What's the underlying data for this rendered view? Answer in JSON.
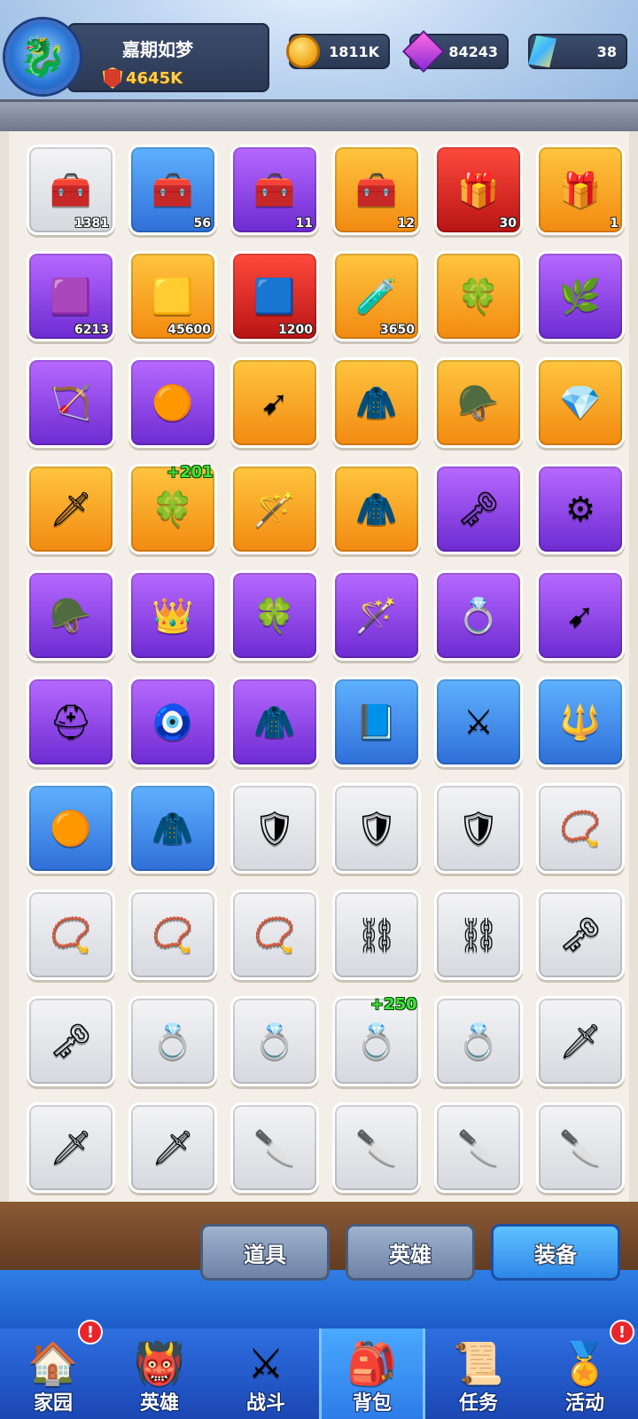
{
  "header": {
    "player_name": "嘉期如梦",
    "power": "4645K",
    "avatar_icon": "dragon-avatar-icon",
    "currencies": [
      {
        "name": "coin",
        "icon": "coin-icon",
        "value": "1811K"
      },
      {
        "name": "gem",
        "icon": "gem-icon",
        "value": "84243"
      },
      {
        "name": "crystal",
        "icon": "crystal-icon",
        "value": "38"
      }
    ]
  },
  "inventory": {
    "items": [
      {
        "icon": "chest",
        "glyph": "🧰",
        "rarity": "gray",
        "count": "1381"
      },
      {
        "icon": "chest",
        "glyph": "🧰",
        "rarity": "blue",
        "count": "56"
      },
      {
        "icon": "chest",
        "glyph": "🧰",
        "rarity": "purple",
        "count": "11"
      },
      {
        "icon": "chest",
        "glyph": "🧰",
        "rarity": "orange",
        "count": "12"
      },
      {
        "icon": "chest",
        "glyph": "🎁",
        "rarity": "red",
        "count": "30"
      },
      {
        "icon": "chest",
        "glyph": "🎁",
        "rarity": "orange",
        "count": "1"
      },
      {
        "icon": "bar",
        "glyph": "🟪",
        "rarity": "purple",
        "count": "6213"
      },
      {
        "icon": "bar",
        "glyph": "🟨",
        "rarity": "orange",
        "count": "45600"
      },
      {
        "icon": "bar",
        "glyph": "🟦",
        "rarity": "red",
        "count": "1200"
      },
      {
        "icon": "potion",
        "glyph": "🧪",
        "rarity": "orange",
        "count": "3650"
      },
      {
        "icon": "clover",
        "glyph": "🍀",
        "rarity": "orange",
        "count": ""
      },
      {
        "icon": "branch",
        "glyph": "🌿",
        "rarity": "purple",
        "count": ""
      },
      {
        "icon": "bow",
        "glyph": "🏹",
        "rarity": "purple",
        "count": ""
      },
      {
        "icon": "belt",
        "glyph": "🟠",
        "rarity": "purple",
        "count": ""
      },
      {
        "icon": "arrow",
        "glyph": "➹",
        "rarity": "orange",
        "count": ""
      },
      {
        "icon": "cape",
        "glyph": "🧥",
        "rarity": "orange",
        "count": ""
      },
      {
        "icon": "helm",
        "glyph": "🪖",
        "rarity": "orange",
        "count": ""
      },
      {
        "icon": "necklace",
        "glyph": "💎",
        "rarity": "orange",
        "count": ""
      },
      {
        "icon": "sword",
        "glyph": "🗡",
        "rarity": "orange",
        "count": ""
      },
      {
        "icon": "clover",
        "glyph": "🍀",
        "rarity": "orange",
        "count": "",
        "plus": "+201"
      },
      {
        "icon": "wand",
        "glyph": "🪄",
        "rarity": "orange",
        "count": ""
      },
      {
        "icon": "cape",
        "glyph": "🧥",
        "rarity": "orange",
        "count": ""
      },
      {
        "icon": "amulet",
        "glyph": "🗝",
        "rarity": "purple",
        "count": ""
      },
      {
        "icon": "amulet",
        "glyph": "⚙",
        "rarity": "purple",
        "count": ""
      },
      {
        "icon": "helm",
        "glyph": "🪖",
        "rarity": "purple",
        "count": ""
      },
      {
        "icon": "crown",
        "glyph": "👑",
        "rarity": "purple",
        "count": ""
      },
      {
        "icon": "clover",
        "glyph": "🍀",
        "rarity": "purple",
        "count": ""
      },
      {
        "icon": "wand",
        "glyph": "🪄",
        "rarity": "purple",
        "count": ""
      },
      {
        "icon": "ring",
        "glyph": "💍",
        "rarity": "purple",
        "count": ""
      },
      {
        "icon": "arrow",
        "glyph": "➹",
        "rarity": "purple",
        "count": ""
      },
      {
        "icon": "helmet",
        "glyph": "⛑",
        "rarity": "purple",
        "count": ""
      },
      {
        "icon": "necklace",
        "glyph": "🧿",
        "rarity": "purple",
        "count": ""
      },
      {
        "icon": "cape",
        "glyph": "🧥",
        "rarity": "purple",
        "count": ""
      },
      {
        "icon": "book",
        "glyph": "📘",
        "rarity": "blue",
        "count": ""
      },
      {
        "icon": "saber",
        "glyph": "⚔",
        "rarity": "blue",
        "count": ""
      },
      {
        "icon": "spear",
        "glyph": "🔱",
        "rarity": "blue",
        "count": ""
      },
      {
        "icon": "belt",
        "glyph": "🟠",
        "rarity": "blue",
        "count": ""
      },
      {
        "icon": "cape",
        "glyph": "🧥",
        "rarity": "blue",
        "count": ""
      },
      {
        "icon": "armor",
        "glyph": "🛡",
        "rarity": "gray",
        "count": ""
      },
      {
        "icon": "armor",
        "glyph": "🛡",
        "rarity": "gray",
        "count": ""
      },
      {
        "icon": "armor",
        "glyph": "🛡",
        "rarity": "gray",
        "count": ""
      },
      {
        "icon": "collar",
        "glyph": "📿",
        "rarity": "gray",
        "count": ""
      },
      {
        "icon": "collar",
        "glyph": "📿",
        "rarity": "gray",
        "count": ""
      },
      {
        "icon": "collar",
        "glyph": "📿",
        "rarity": "gray",
        "count": ""
      },
      {
        "icon": "collar",
        "glyph": "📿",
        "rarity": "gray",
        "count": ""
      },
      {
        "icon": "chain",
        "glyph": "⛓",
        "rarity": "gray",
        "count": ""
      },
      {
        "icon": "chain",
        "glyph": "⛓",
        "rarity": "gray",
        "count": ""
      },
      {
        "icon": "amulet",
        "glyph": "🗝",
        "rarity": "gray",
        "count": ""
      },
      {
        "icon": "amulet",
        "glyph": "🗝",
        "rarity": "gray",
        "count": ""
      },
      {
        "icon": "ring",
        "glyph": "💍",
        "rarity": "gray",
        "count": ""
      },
      {
        "icon": "ring",
        "glyph": "💍",
        "rarity": "gray",
        "count": ""
      },
      {
        "icon": "ring",
        "glyph": "💍",
        "rarity": "gray",
        "count": "",
        "plus": "+250"
      },
      {
        "icon": "ring",
        "glyph": "💍",
        "rarity": "gray",
        "count": ""
      },
      {
        "icon": "sword",
        "glyph": "🗡",
        "rarity": "gray",
        "count": ""
      },
      {
        "icon": "sword",
        "glyph": "🗡",
        "rarity": "gray",
        "count": ""
      },
      {
        "icon": "sword",
        "glyph": "🗡",
        "rarity": "gray",
        "count": ""
      },
      {
        "icon": "dagger",
        "glyph": "🔪",
        "rarity": "gray",
        "count": ""
      },
      {
        "icon": "dagger",
        "glyph": "🔪",
        "rarity": "gray",
        "count": ""
      },
      {
        "icon": "dagger",
        "glyph": "🔪",
        "rarity": "gray",
        "count": ""
      },
      {
        "icon": "dagger",
        "glyph": "🔪",
        "rarity": "gray",
        "count": ""
      }
    ]
  },
  "tabs": [
    {
      "label": "道具",
      "active": false
    },
    {
      "label": "英雄",
      "active": false
    },
    {
      "label": "装备",
      "active": true
    }
  ],
  "nav": [
    {
      "label": "家园",
      "icon": "home-icon",
      "glyph": "🏠",
      "alert": "!"
    },
    {
      "label": "英雄",
      "icon": "hero-icon",
      "glyph": "👹",
      "alert": ""
    },
    {
      "label": "战斗",
      "icon": "battle-icon",
      "glyph": "⚔",
      "alert": ""
    },
    {
      "label": "背包",
      "icon": "backpack-icon",
      "glyph": "🎒",
      "alert": "",
      "active": true
    },
    {
      "label": "任务",
      "icon": "quest-icon",
      "glyph": "📜",
      "alert": ""
    },
    {
      "label": "活动",
      "icon": "event-icon",
      "glyph": "🏅",
      "alert": "!"
    }
  ]
}
